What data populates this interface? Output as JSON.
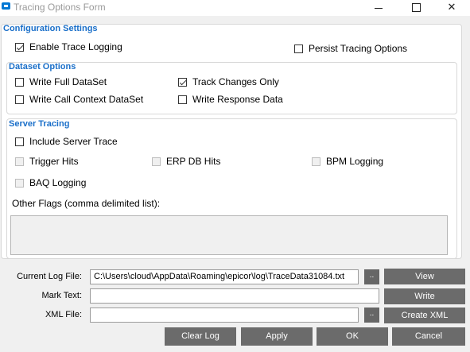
{
  "window": {
    "title": "Tracing Options Form",
    "minimize_glyph": "",
    "maximize_glyph": "",
    "close_glyph": "✕"
  },
  "config": {
    "title": "Configuration Settings",
    "enable_trace": {
      "label": "Enable Trace Logging",
      "checked": true
    },
    "persist": {
      "label": "Persist Tracing Options",
      "checked": false
    }
  },
  "dataset": {
    "title": "Dataset Options",
    "write_full": {
      "label": "Write Full DataSet",
      "checked": false
    },
    "track_changes": {
      "label": "Track Changes Only",
      "checked": true
    },
    "write_call_context": {
      "label": "Write Call Context DataSet",
      "checked": false
    },
    "write_response": {
      "label": "Write Response Data",
      "checked": false
    }
  },
  "server": {
    "title": "Server Tracing",
    "include_server_trace": {
      "label": "Include Server Trace",
      "checked": false
    },
    "trigger_hits": {
      "label": "Trigger Hits",
      "checked": false,
      "disabled": true
    },
    "erp_db_hits": {
      "label": "ERP DB Hits",
      "checked": false,
      "disabled": true
    },
    "bpm_logging": {
      "label": "BPM Logging",
      "checked": false,
      "disabled": true
    },
    "baq_logging": {
      "label": "BAQ Logging",
      "checked": false,
      "disabled": true
    },
    "other_flags_label": "Other Flags (comma delimited list):",
    "other_flags_value": ""
  },
  "files": {
    "current_log_label": "Current Log File:",
    "current_log_value": "C:\\Users\\cloud\\AppData\\Roaming\\epicor\\log\\TraceData31084.txt",
    "mark_text_label": "Mark Text:",
    "mark_text_value": "",
    "xml_file_label": "XML File:",
    "xml_file_value": "",
    "browse_label": "..",
    "view_label": "View",
    "write_label": "Write",
    "create_xml_label": "Create XML"
  },
  "footer": {
    "clear_log": "Clear Log",
    "apply": "Apply",
    "ok": "OK",
    "cancel": "Cancel"
  },
  "colors": {
    "group_title": "#1a6fc9",
    "button_bg": "#6b6b6b",
    "app_icon": "#0078d4"
  }
}
